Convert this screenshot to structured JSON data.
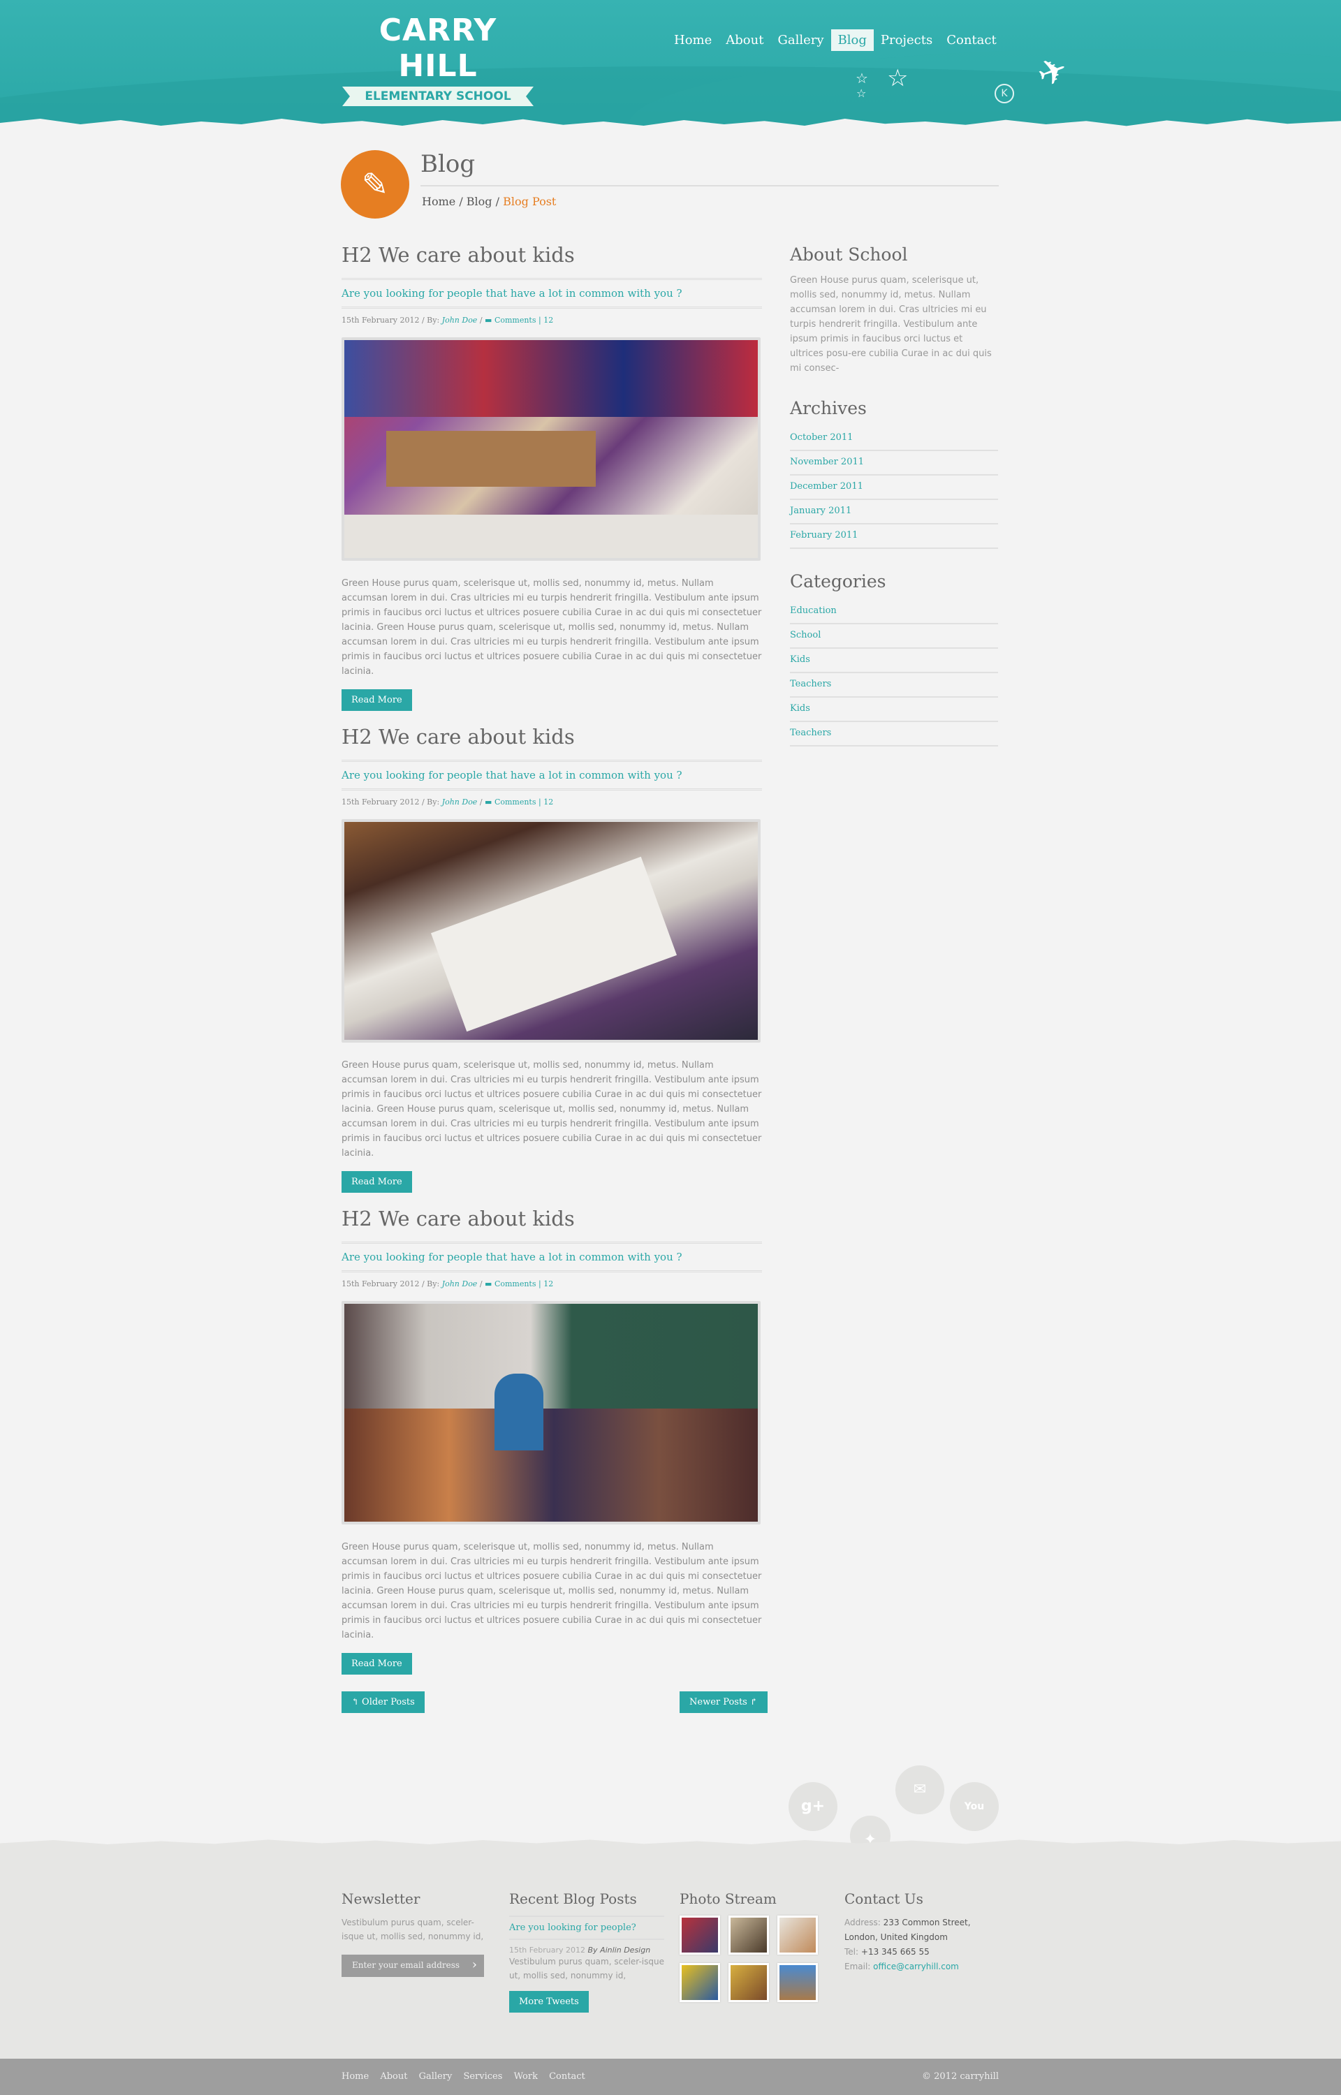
{
  "logo": {
    "name": "CARRY HILL",
    "tagline": "ELEMENTARY SCHOOL"
  },
  "nav": [
    "Home",
    "About",
    "Gallery",
    "Blog",
    "Projects",
    "Contact"
  ],
  "nav_active": "Blog",
  "page": {
    "title": "Blog",
    "crumbs": [
      "Home",
      "Blog"
    ],
    "current": "Blog Post"
  },
  "posts": [
    {
      "title": "H2 We care about kids",
      "subtitle": "Are you looking for people that have a lot in common with you ?",
      "date": "15th February 2012",
      "by": "By:",
      "author": "John Doe",
      "comments": "Comments | 12",
      "body": "Green House purus quam, scelerisque ut, mollis sed, nonummy id, metus. Nullam accumsan lorem in dui. Cras ultricies mi eu turpis hendrerit fringilla. Vestibulum ante ipsum primis in faucibus orci luctus et ultrices posuere cubilia Curae in ac dui quis mi consectetuer lacinia. Green House purus quam, scelerisque ut, mollis sed, nonummy id, metus. Nullam accumsan lorem in dui. Cras ultricies mi eu turpis hendrerit fringilla. Vestibulum ante ipsum primis in faucibus orci luctus et ultrices posuere cubilia Curae in ac dui quis mi consectetuer lacinia.",
      "button": "Read More"
    },
    {
      "title": "H2 We care about kids",
      "subtitle": "Are you looking for people that have a lot in common with you ?",
      "date": "15th February 2012",
      "by": "By:",
      "author": "John Doe",
      "comments": "Comments | 12",
      "body": "Green House purus quam, scelerisque ut, mollis sed, nonummy id, metus. Nullam accumsan lorem in dui. Cras ultricies mi eu turpis hendrerit fringilla. Vestibulum ante ipsum primis in faucibus orci luctus et ultrices posuere cubilia Curae in ac dui quis mi consectetuer lacinia. Green House purus quam, scelerisque ut, mollis sed, nonummy id, metus. Nullam accumsan lorem in dui. Cras ultricies mi eu turpis hendrerit fringilla. Vestibulum ante ipsum primis in faucibus orci luctus et ultrices posuere cubilia Curae in ac dui quis mi consectetuer lacinia.",
      "button": "Read More"
    },
    {
      "title": "H2 We care about kids",
      "subtitle": "Are you looking for people that have a lot in common with you ?",
      "date": "15th February 2012",
      "by": "By:",
      "author": "John Doe",
      "comments": "Comments | 12",
      "body": "Green House purus quam, scelerisque ut, mollis sed, nonummy id, metus. Nullam accumsan lorem in dui. Cras ultricies mi eu turpis hendrerit fringilla. Vestibulum ante ipsum primis in faucibus orci luctus et ultrices posuere cubilia Curae in ac dui quis mi consectetuer lacinia. Green House purus quam, scelerisque ut, mollis sed, nonummy id, metus. Nullam accumsan lorem in dui. Cras ultricies mi eu turpis hendrerit fringilla. Vestibulum ante ipsum primis in faucibus orci luctus et ultrices posuere cubilia Curae in ac dui quis mi consectetuer lacinia.",
      "button": "Read More"
    }
  ],
  "pager": {
    "older": "Older Posts",
    "newer": "Newer Posts"
  },
  "sidebar": {
    "about_title": "About School",
    "about_text": "Green House purus quam, scelerisque ut, mollis sed, nonummy id, metus. Nullam accumsan lorem in dui. Cras ultricies mi eu turpis hendrerit fringilla. Vestibulum ante ipsum primis in faucibus orci luctus et ultrices posu-ere cubilia Curae in ac dui quis mi consec-",
    "archives_title": "Archives",
    "archives": [
      "October 2011",
      "November 2011",
      "December 2011",
      "January 2011",
      "February 2011"
    ],
    "categories_title": "Categories",
    "categories": [
      "Education",
      "School",
      "Kids",
      "Teachers",
      "Kids",
      "Teachers"
    ]
  },
  "social": [
    "google-plus-icon",
    "twitter-bird-icon",
    "email-icon",
    "youtube-icon"
  ],
  "footer": {
    "newsletter": {
      "title": "Newsletter",
      "text": "Vestibulum purus quam, sceler-isque ut, mollis sed, nonummy id,",
      "placeholder": "Enter your email address"
    },
    "recent": {
      "title": "Recent Blog Posts",
      "link": "Are you looking for people?",
      "date": "15th February 2012",
      "author": "By Ainlin Design",
      "text": "Vestibulum purus quam, sceler-isque ut, mollis sed, nonummy id,",
      "button": "More Tweets"
    },
    "photostream": {
      "title": "Photo Stream"
    },
    "contact": {
      "title": "Contact Us",
      "address_label": "Address:",
      "address1": "233 Common Street,",
      "address2": "London, United Kingdom",
      "tel_label": "Tel:",
      "tel": "+13 345 665 55",
      "email_label": "Email:",
      "email": "office@carryhill.com"
    }
  },
  "bottom": {
    "links": [
      "Home",
      "About",
      "Gallery",
      "Services",
      "Work",
      "Contact"
    ],
    "copyright": "© 2012 carryhill"
  },
  "colors": {
    "teal": "#2aa7a6",
    "orange": "#e67e22",
    "footer": "#e6e6e4"
  }
}
